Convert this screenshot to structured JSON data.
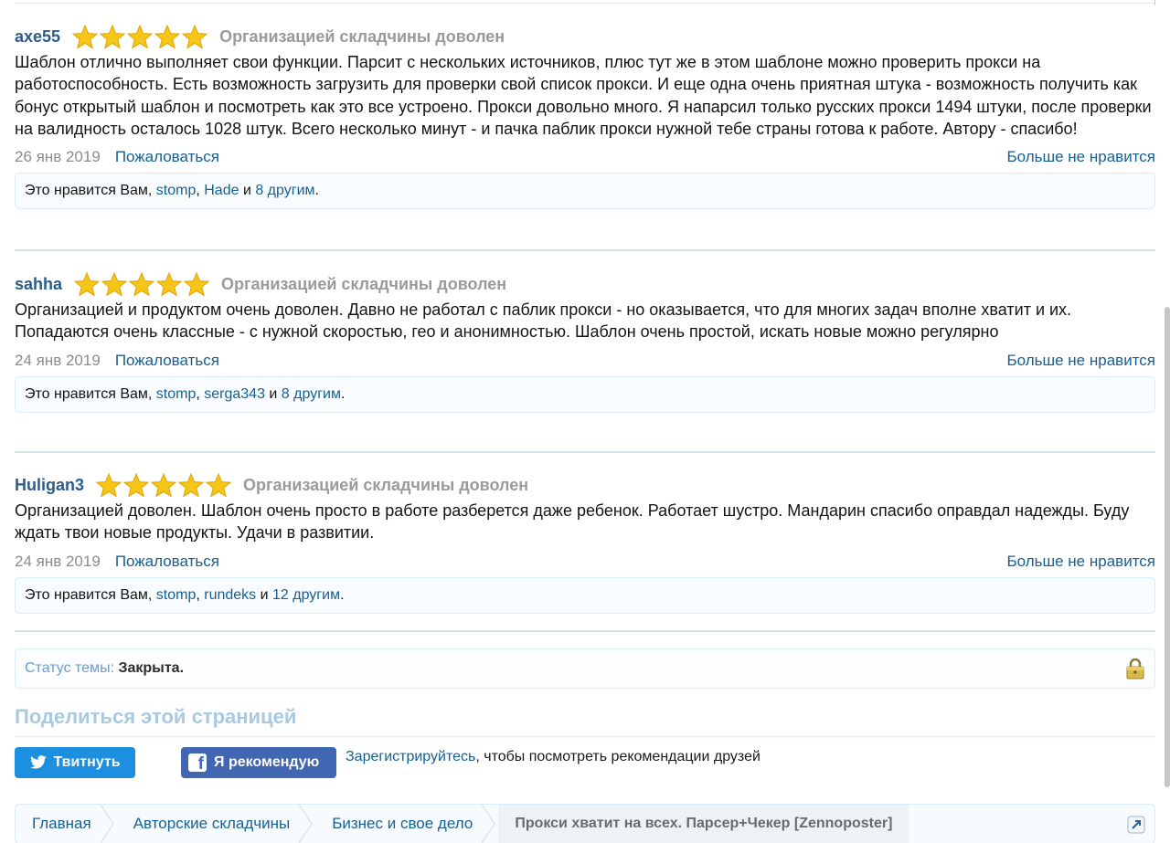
{
  "reviews": [
    {
      "username": "axe55",
      "rating": 5,
      "rating_label": "Организацией складчины доволен",
      "text": "Шаблон отлично выполняет свои функции. Парсит с нескольких источников, плюс тут же в этом шаблоне можно проверить прокси на работоспособность. Есть возможность загрузить для проверки свой список прокси. И еще одна очень приятная штука - возможность получить как бонус открытый шаблон и посмотреть как это все устроено. Прокси довольно много. Я напарсил только русских прокси 1494 штуки, после проверки на валидность осталось 1028 штук. Всего несколько минут - и пачка паблик прокси нужной тебе страны готова к работе. Автору - спасибо!",
      "date": "26 янв 2019",
      "report_label": "Пожаловаться",
      "unlike_label": "Больше не нравится",
      "likes_prefix": "Это нравится Вам, ",
      "likes_user1": "stomp",
      "likes_comma": ", ",
      "likes_user2": "Hade",
      "likes_and": " и ",
      "likes_others": "8 другим",
      "likes_end": "."
    },
    {
      "username": "sahha",
      "rating": 5,
      "rating_label": "Организацией складчины доволен",
      "text": "Организацией и продуктом очень доволен. Давно не работал с паблик прокси - но оказывается, что для многих задач вполне хватит и их. Попадаются очень классные - с нужной скоростью, гео и анонимностью. Шаблон очень простой, искать новые можно регулярно",
      "date": "24 янв 2019",
      "report_label": "Пожаловаться",
      "unlike_label": "Больше не нравится",
      "likes_prefix": "Это нравится Вам, ",
      "likes_user1": "stomp",
      "likes_comma": ", ",
      "likes_user2": "serga343",
      "likes_and": " и ",
      "likes_others": "8 другим",
      "likes_end": "."
    },
    {
      "username": "Huligan3",
      "rating": 5,
      "rating_label": "Организацией складчины доволен",
      "text": "Организацией доволен. Шаблон очень просто в работе разберется даже ребенок. Работает шустро. Мандарин спасибо оправдал надежды. Буду ждать твои новые продукты. Удачи в развитии.",
      "date": "24 янв 2019",
      "report_label": "Пожаловаться",
      "unlike_label": "Больше не нравится",
      "likes_prefix": "Это нравится Вам, ",
      "likes_user1": "stomp",
      "likes_comma": ", ",
      "likes_user2": "rundeks",
      "likes_and": " и ",
      "likes_others": "12 другим",
      "likes_end": "."
    }
  ],
  "thread_status": {
    "label": "Статус темы: ",
    "value": "Закрыта.",
    "icon": "lock-icon"
  },
  "share": {
    "title": "Поделиться этой страницей",
    "tweet_label": "Твитнуть",
    "fb_label": "Я рекомендую",
    "fb_note_link": "Зарегистрируйтесь",
    "fb_note_text": ", чтобы посмотреть рекомендации друзей"
  },
  "breadcrumb": [
    "Главная",
    "Авторские складчины",
    "Бизнес и свое дело",
    "Прокси хватит на всех. Парсер+Чекер [Zennoposter]"
  ],
  "colors": {
    "link": "#176093",
    "username": "#2b5c8a",
    "star": "#f5c518",
    "twitter": "#1d8fe0",
    "facebook": "#4267b2"
  }
}
